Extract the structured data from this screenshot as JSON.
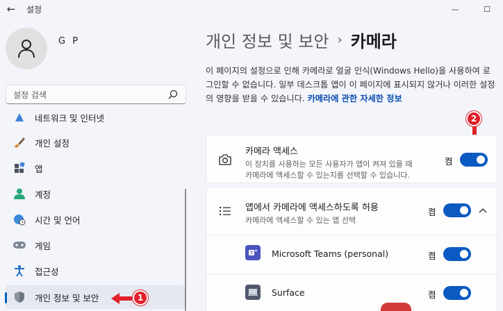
{
  "titlebar": {
    "app_title": "설정",
    "back_glyph": "←",
    "min_glyph": "—",
    "max_glyph": "☐"
  },
  "profile": {
    "name": "G P"
  },
  "search": {
    "placeholder": "설정 검색"
  },
  "sidebar": {
    "partial_item": "네트워크 및 인터넷",
    "items": [
      {
        "label": "개인 설정",
        "icon": "brush-icon"
      },
      {
        "label": "앱",
        "icon": "apps-icon"
      },
      {
        "label": "계정",
        "icon": "account-icon"
      },
      {
        "label": "시간 및 언어",
        "icon": "globe-clock-icon"
      },
      {
        "label": "게임",
        "icon": "gamepad-icon"
      },
      {
        "label": "접근성",
        "icon": "accessibility-icon"
      },
      {
        "label": "개인 정보 및 보안",
        "icon": "shield-icon",
        "selected": true
      }
    ]
  },
  "breadcrumb": {
    "parent": "개인 정보 및 보안",
    "separator": "›",
    "current": "카메라"
  },
  "description": {
    "text": "이 페이지의 설정으로 인해 카메라로 얼굴 인식(Windows Hello)을 사용하여 로그인할 수 없습니다. 일부 데스크톱 앱이 이 페이지에 표시되지 않거나 이러한 설정의 영향을 받을 수 있습니다. ",
    "link": "카메라에 관한 자세한 정보"
  },
  "camera_access": {
    "title": "카메라 액세스",
    "subtitle_line1": "이 장치를 사용하는 모든 사용자가 앱이 켜져 있을 때",
    "subtitle_line2": "카메라에 액세스할 수 있는지를 선택할 수 있습니다.",
    "state": "켬",
    "on": true
  },
  "app_access": {
    "title": "앱에서 카메라에 액세스하도록 허용",
    "subtitle": "카메라에 액세스할 수 있는 앱 선택",
    "state": "켬",
    "on": true
  },
  "apps": [
    {
      "name": "Microsoft Teams (personal)",
      "state": "켬",
      "on": true,
      "icon": "teams-icon"
    },
    {
      "name": "Surface",
      "state": "켬",
      "on": true,
      "icon": "surface-icon"
    }
  ],
  "annotations": {
    "one": "1",
    "two": "2"
  },
  "colors": {
    "accent": "#0a5ac2",
    "annotation": "#e0202a",
    "link": "#0a4db0"
  }
}
